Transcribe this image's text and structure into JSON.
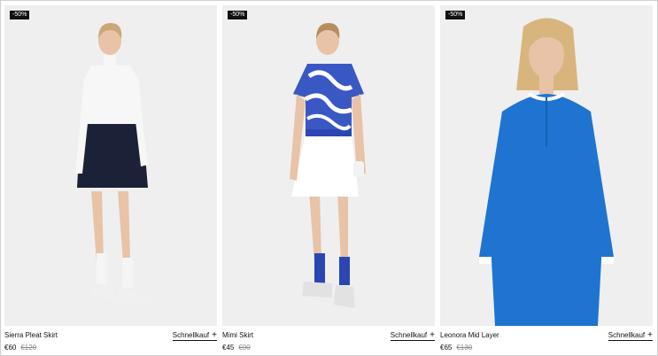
{
  "products": [
    {
      "badge": "-50%",
      "name": "Sierra Pleat Skirt",
      "price": "€60",
      "old_price": "€120",
      "quick_label": "Schnellkauf",
      "plus": "+"
    },
    {
      "badge": "-50%",
      "name": "Mimi Skirt",
      "price": "€45",
      "old_price": "€90",
      "quick_label": "Schnellkauf",
      "plus": "+"
    },
    {
      "badge": "-50%",
      "name": "Leonora Mid Layer",
      "price": "€65",
      "old_price": "€130",
      "quick_label": "Schnellkauf",
      "plus": "+"
    }
  ],
  "colors": {
    "white_top": "#f7f7f7",
    "navy": "#1b2238",
    "blue": "#1e74d0",
    "royal": "#2b45b3",
    "skin": "#e8c3a7"
  }
}
